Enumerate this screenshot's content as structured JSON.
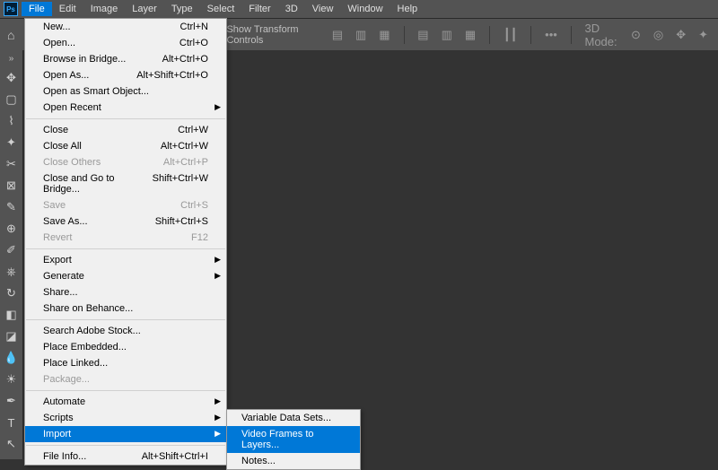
{
  "app_icon_text": "Ps",
  "menubar": [
    "File",
    "Edit",
    "Image",
    "Layer",
    "Type",
    "Select",
    "Filter",
    "3D",
    "View",
    "Window",
    "Help"
  ],
  "active_menu_index": 0,
  "options_bar": {
    "transform_label": "Show Transform Controls",
    "mode_label": "3D Mode:"
  },
  "file_menu": [
    {
      "label": "New...",
      "shortcut": "Ctrl+N"
    },
    {
      "label": "Open...",
      "shortcut": "Ctrl+O"
    },
    {
      "label": "Browse in Bridge...",
      "shortcut": "Alt+Ctrl+O"
    },
    {
      "label": "Open As...",
      "shortcut": "Alt+Shift+Ctrl+O"
    },
    {
      "label": "Open as Smart Object..."
    },
    {
      "label": "Open Recent",
      "submenu": true
    },
    {
      "sep": true
    },
    {
      "label": "Close",
      "shortcut": "Ctrl+W"
    },
    {
      "label": "Close All",
      "shortcut": "Alt+Ctrl+W"
    },
    {
      "label": "Close Others",
      "shortcut": "Alt+Ctrl+P",
      "disabled": true
    },
    {
      "label": "Close and Go to Bridge...",
      "shortcut": "Shift+Ctrl+W"
    },
    {
      "label": "Save",
      "shortcut": "Ctrl+S",
      "disabled": true
    },
    {
      "label": "Save As...",
      "shortcut": "Shift+Ctrl+S"
    },
    {
      "label": "Revert",
      "shortcut": "F12",
      "disabled": true
    },
    {
      "sep": true
    },
    {
      "label": "Export",
      "submenu": true
    },
    {
      "label": "Generate",
      "submenu": true
    },
    {
      "label": "Share..."
    },
    {
      "label": "Share on Behance..."
    },
    {
      "sep": true
    },
    {
      "label": "Search Adobe Stock..."
    },
    {
      "label": "Place Embedded..."
    },
    {
      "label": "Place Linked..."
    },
    {
      "label": "Package...",
      "disabled": true
    },
    {
      "sep": true
    },
    {
      "label": "Automate",
      "submenu": true
    },
    {
      "label": "Scripts",
      "submenu": true
    },
    {
      "label": "Import",
      "submenu": true,
      "highlighted": true
    },
    {
      "sep": true
    },
    {
      "label": "File Info...",
      "shortcut": "Alt+Shift+Ctrl+I"
    }
  ],
  "import_submenu": [
    {
      "label": "Variable Data Sets...",
      "disabled": true
    },
    {
      "label": "Video Frames to Layers...",
      "highlighted": true
    },
    {
      "label": "Notes...",
      "disabled": true
    }
  ],
  "tools": [
    "move",
    "marquee",
    "lasso",
    "magic-wand",
    "crop",
    "frame",
    "eyedropper",
    "healing",
    "brush",
    "clone",
    "history-brush",
    "eraser",
    "gradient",
    "blur",
    "dodge",
    "pen",
    "type",
    "path"
  ]
}
